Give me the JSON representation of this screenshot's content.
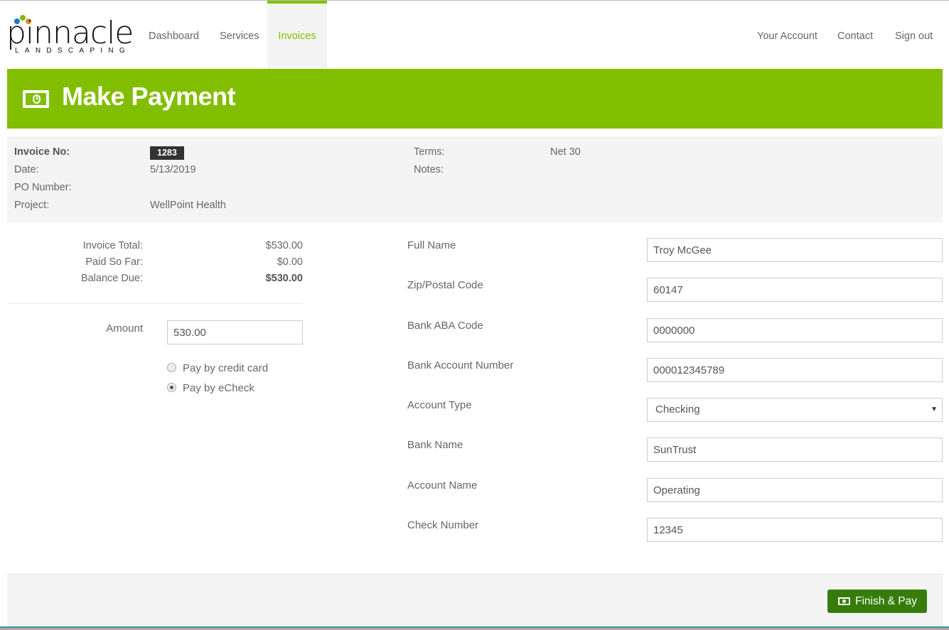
{
  "brand": {
    "name": "pinnacle",
    "tagline": "LANDSCAPING"
  },
  "nav": {
    "left": [
      {
        "label": "Dashboard"
      },
      {
        "label": "Services"
      },
      {
        "label": "Invoices",
        "active": true
      }
    ],
    "right": [
      {
        "label": "Your Account"
      },
      {
        "label": "Contact"
      },
      {
        "label": "Sign out"
      }
    ]
  },
  "page": {
    "title": "Make Payment",
    "icon": "money-bill-icon"
  },
  "invoice": {
    "invoice_no_label": "Invoice No:",
    "invoice_no": "1283",
    "date_label": "Date:",
    "date": "5/13/2019",
    "po_label": "PO Number:",
    "po": "",
    "project_label": "Project:",
    "project": "WellPoint Health",
    "terms_label": "Terms:",
    "terms": "Net 30",
    "notes_label": "Notes:",
    "notes": ""
  },
  "summary": {
    "total_label": "Invoice Total:",
    "total": "$530.00",
    "paid_label": "Paid So Far:",
    "paid": "$0.00",
    "balance_label": "Balance Due:",
    "balance": "$530.00"
  },
  "payment": {
    "amount_label": "Amount",
    "amount": "530.00",
    "methods": [
      {
        "label": "Pay by credit card",
        "selected": false
      },
      {
        "label": "Pay by eCheck",
        "selected": true
      }
    ]
  },
  "form": {
    "full_name": {
      "label": "Full Name",
      "value": "Troy McGee"
    },
    "zip": {
      "label": "Zip/Postal Code",
      "value": "60147"
    },
    "aba": {
      "label": "Bank ABA Code",
      "value": "0000000"
    },
    "account_number": {
      "label": "Bank Account Number",
      "value": "000012345789"
    },
    "account_type": {
      "label": "Account Type",
      "value": "Checking"
    },
    "bank_name": {
      "label": "Bank Name",
      "value": "SunTrust"
    },
    "account_name": {
      "label": "Account Name",
      "value": "Operating"
    },
    "check_number": {
      "label": "Check Number",
      "value": "12345"
    }
  },
  "footer": {
    "submit_label": "Finish & Pay"
  },
  "colors": {
    "brand_green": "#82be00",
    "button_green": "#367c0a",
    "badge_bg": "#333333"
  }
}
